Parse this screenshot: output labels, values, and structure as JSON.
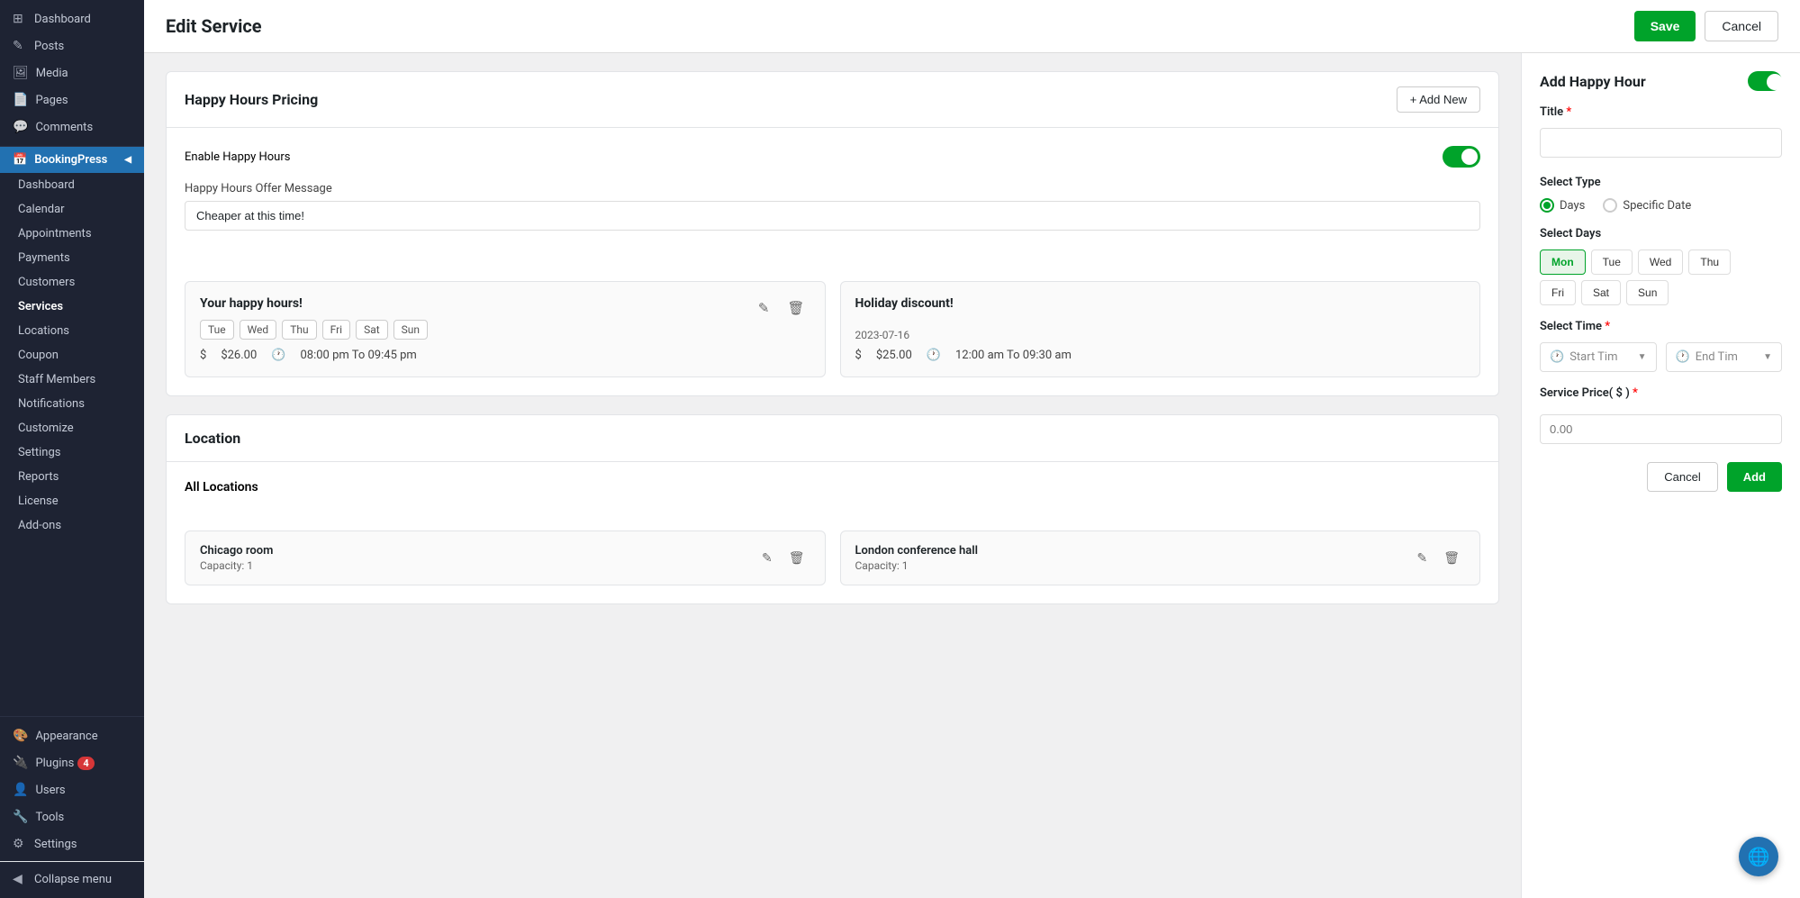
{
  "sidebar": {
    "wp_items": [
      {
        "label": "Dashboard",
        "icon": "⊞"
      },
      {
        "label": "Posts",
        "icon": "✎"
      },
      {
        "label": "Media",
        "icon": "🖼"
      },
      {
        "label": "Pages",
        "icon": "📄"
      },
      {
        "label": "Comments",
        "icon": "💬"
      }
    ],
    "bookingpress_label": "BookingPress",
    "bp_items": [
      {
        "label": "Dashboard",
        "active": false
      },
      {
        "label": "Calendar",
        "active": false
      },
      {
        "label": "Appointments",
        "active": false
      },
      {
        "label": "Payments",
        "active": false
      },
      {
        "label": "Customers",
        "active": false
      },
      {
        "label": "Services",
        "active": true
      },
      {
        "label": "Locations",
        "active": false
      },
      {
        "label": "Coupon",
        "active": false
      },
      {
        "label": "Staff Members",
        "active": false
      },
      {
        "label": "Notifications",
        "active": false
      },
      {
        "label": "Customize",
        "active": false
      },
      {
        "label": "Settings",
        "active": false
      },
      {
        "label": "Reports",
        "active": false
      },
      {
        "label": "License",
        "active": false
      },
      {
        "label": "Add-ons",
        "active": false
      }
    ],
    "bottom_items": [
      {
        "label": "Appearance",
        "icon": "🎨"
      },
      {
        "label": "Plugins",
        "icon": "🔌",
        "badge": "4"
      },
      {
        "label": "Users",
        "icon": "👤"
      },
      {
        "label": "Tools",
        "icon": "🔧"
      },
      {
        "label": "Settings",
        "icon": "⚙"
      }
    ],
    "collapse_label": "Collapse menu"
  },
  "header": {
    "title": "Edit Service",
    "save_label": "Save",
    "cancel_label": "Cancel"
  },
  "happy_hours_section": {
    "title": "Happy Hours Pricing",
    "add_new_label": "+ Add New",
    "enable_label": "Enable Happy Hours",
    "offer_message_label": "Happy Hours Offer Message",
    "offer_message_value": "Cheaper at this time!",
    "cards": [
      {
        "title": "Your happy hours!",
        "days": [
          "Tue",
          "Wed",
          "Thu",
          "Fri",
          "Sat",
          "Sun"
        ],
        "price": "$26.00",
        "time": "08:00 pm To 09:45 pm"
      },
      {
        "title": "Holiday discount!",
        "date": "2023-07-16",
        "price": "$25.00",
        "time": "12:00 am To 09:30 am"
      }
    ]
  },
  "location_section": {
    "title": "Location",
    "all_locations_label": "All Locations",
    "locations": [
      {
        "name": "Chicago room",
        "capacity": "Capacity: 1"
      },
      {
        "name": "London conference hall",
        "capacity": "Capacity: 1"
      }
    ]
  },
  "right_panel": {
    "title": "Add Happy Hour",
    "title_label": "Title",
    "title_required": "*",
    "select_type_label": "Select Type",
    "type_options": [
      {
        "label": "Days",
        "selected": true
      },
      {
        "label": "Specific Date",
        "selected": false
      }
    ],
    "select_days_label": "Select Days",
    "days": [
      {
        "label": "Mon",
        "active": true
      },
      {
        "label": "Tue",
        "active": false
      },
      {
        "label": "Wed",
        "active": false
      },
      {
        "label": "Thu",
        "active": false
      },
      {
        "label": "Fri",
        "active": false
      },
      {
        "label": "Sat",
        "active": false
      },
      {
        "label": "Sun",
        "active": false
      }
    ],
    "select_time_label": "Select Time",
    "select_time_required": "*",
    "start_time_placeholder": "Start Tim",
    "end_time_placeholder": "End Tim",
    "service_price_label": "Service Price( $ )",
    "service_price_required": "*",
    "price_placeholder": "0.00",
    "cancel_label": "Cancel",
    "add_label": "Add"
  },
  "float_help_icon": "🌐"
}
